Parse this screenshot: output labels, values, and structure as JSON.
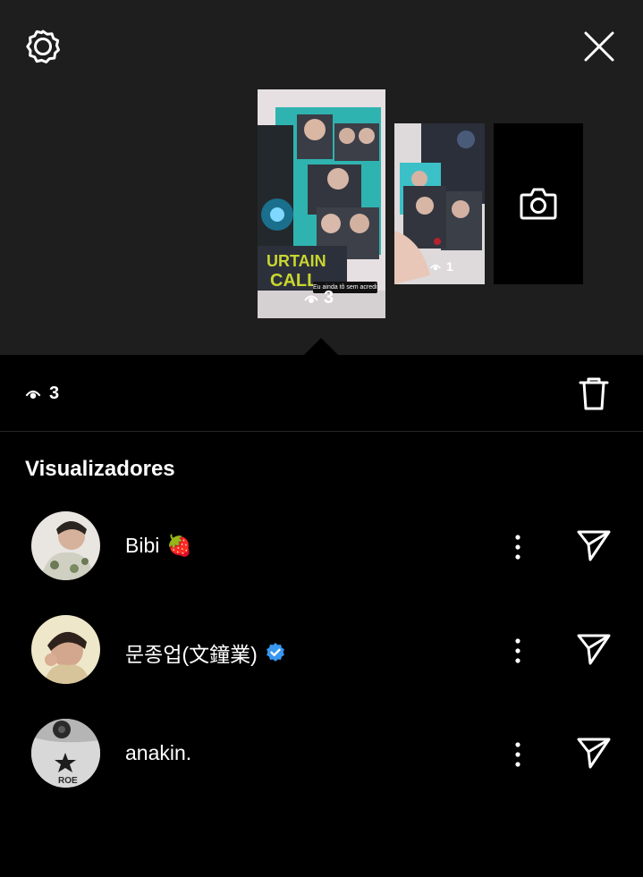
{
  "header": {
    "settings_icon": "gear-icon",
    "close_icon": "close-icon"
  },
  "stories": {
    "main": {
      "views": "3",
      "caption": "Eu ainda tô sem acreditar"
    },
    "second": {
      "views": "1"
    },
    "add_icon": "camera-icon"
  },
  "toolbar": {
    "view_count": "3",
    "delete_icon": "trash-icon"
  },
  "viewers_section": {
    "title": "Visualizadores"
  },
  "viewers": [
    {
      "name": "Bibi",
      "emoji": "🍓",
      "verified": false
    },
    {
      "name": "문종업(文鐘業)",
      "emoji": "",
      "verified": true
    },
    {
      "name": "anakin.",
      "emoji": "",
      "verified": false
    }
  ],
  "colors": {
    "background": "#000000",
    "top_area": "#1e1e1e",
    "verified_badge": "#3897f0",
    "text": "#ffffff"
  }
}
